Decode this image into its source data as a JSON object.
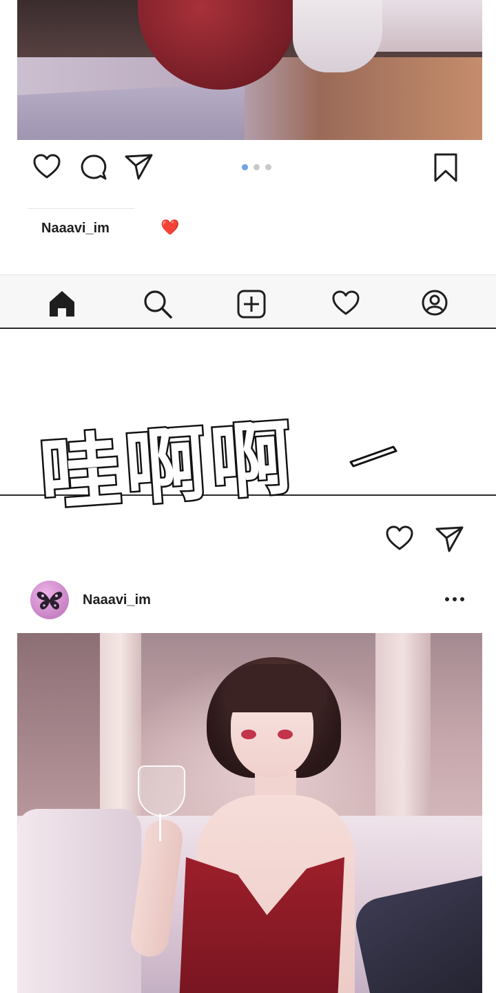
{
  "top_post": {
    "carousel": {
      "count": 3,
      "active_index": 0
    },
    "caption": {
      "username": "Naaavi_im",
      "emoji": "❤️"
    }
  },
  "tab_bar": {
    "items": [
      {
        "name": "home",
        "icon": "home-icon",
        "active": true
      },
      {
        "name": "search",
        "icon": "search-icon",
        "active": false
      },
      {
        "name": "new-post",
        "icon": "plus-square-icon",
        "active": false
      },
      {
        "name": "activity",
        "icon": "heart-icon",
        "active": false
      },
      {
        "name": "profile",
        "icon": "profile-icon",
        "active": false
      }
    ]
  },
  "sound_effect": {
    "text": "哇啊啊"
  },
  "second_post": {
    "username": "Naaavi_im",
    "avatar_icon": "butterfly-icon",
    "more_icon": "more-horizontal-icon"
  },
  "colors": {
    "accent_dot": "#6fa3e6",
    "heart_emoji": "#e0202a",
    "icon_stroke": "#1e1e1e"
  }
}
